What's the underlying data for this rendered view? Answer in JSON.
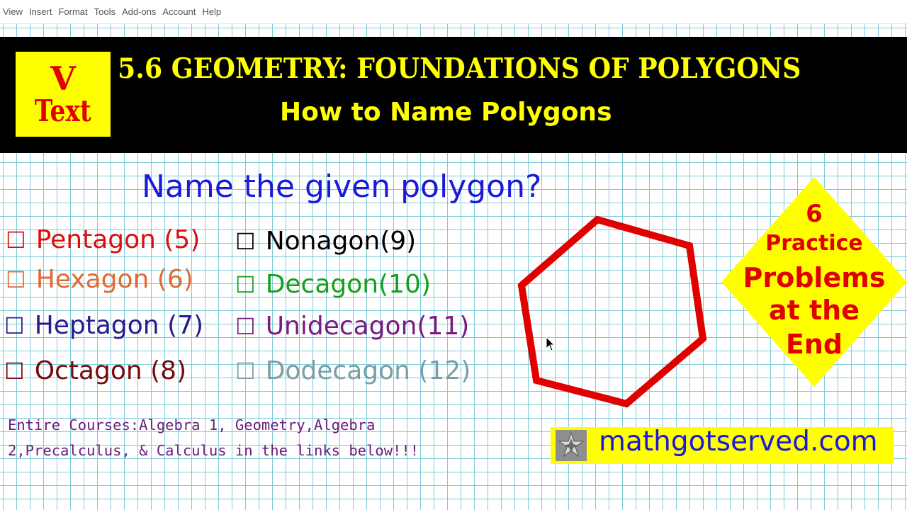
{
  "menu": [
    "View",
    "Insert",
    "Format",
    "Tools",
    "Add-ons",
    "Account",
    "Help"
  ],
  "logo": {
    "line1": "V",
    "line2": "Text"
  },
  "banner": {
    "title": "5.6 GEOMETRY: FOUNDATIONS OF POLYGONS",
    "subtitle": "How to Name Polygons"
  },
  "question": "Name the given polygon?",
  "checkbox_glyph": "☐",
  "options_left": [
    {
      "label": "Pentagon (5)",
      "color": "#d81010"
    },
    {
      "label": "Hexagon (6)",
      "color": "#e06a35"
    },
    {
      "label": "Heptagon (7)",
      "color": "#2a1a8a"
    },
    {
      "label": "Octagon (8)",
      "color": "#7a0a0a"
    }
  ],
  "options_right": [
    {
      "label": "Nonagon(9)",
      "color": "#000000"
    },
    {
      "label": "Decagon(10)",
      "color": "#12a020"
    },
    {
      "label": "Unidecagon(11)",
      "color": "#7a1a80"
    },
    {
      "label": "Dodecagon (12)",
      "color": "#7a9ea8"
    }
  ],
  "footer_note": {
    "line1": "Entire Courses:Algebra 1, Geometry,Algebra",
    "line2": "2,Precalculus, & Calculus in the links below!!!"
  },
  "diamond": {
    "line1": "6",
    "line2": "Practice",
    "line3": "Problems",
    "line4": "at the",
    "line5": "End",
    "fill": "#ffff00",
    "text_color": "#e00000"
  },
  "site": {
    "url": "mathgotserved.com"
  },
  "polygon": {
    "sides": 6,
    "stroke": "#e00000"
  },
  "icons": {
    "cursor": "arrow-cursor-icon",
    "site_logo": "star-polyhedron-icon"
  }
}
